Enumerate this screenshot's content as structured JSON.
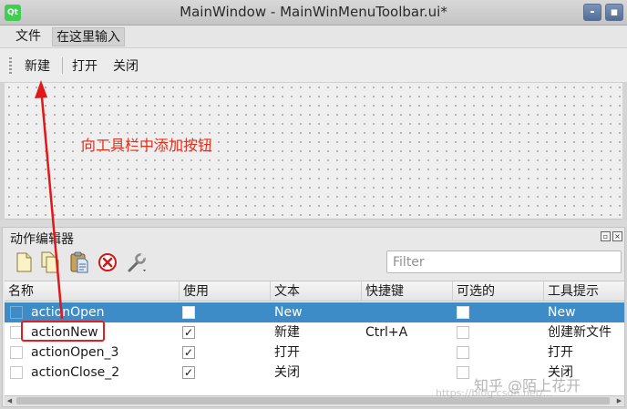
{
  "window": {
    "title": "MainWindow - MainWinMenuToolbar.ui*",
    "app_icon": "Qt",
    "minimize": "-",
    "maximize": "▪"
  },
  "menubar": {
    "file": "文件",
    "type_here": "在这里输入"
  },
  "toolbar": {
    "new": "新建",
    "open": "打开",
    "close": "关闭"
  },
  "annotation": {
    "text": "向工具栏中添加按钮",
    "color": "#e0301e"
  },
  "action_editor": {
    "title": "动作编辑器",
    "tools": [
      "new-action-icon",
      "copy-icon",
      "paste-icon",
      "delete-icon",
      "configure-icon"
    ],
    "filter_placeholder": "Filter",
    "columns": [
      "名称",
      "使用",
      "文本",
      "快捷键",
      "可选的",
      "工具提示"
    ],
    "rows": [
      {
        "name": "actionOpen",
        "used": false,
        "text": "New",
        "shortcut": "",
        "checkable": false,
        "tooltip": "New",
        "selected": true
      },
      {
        "name": "actionNew",
        "used": true,
        "text": "新建",
        "shortcut": "Ctrl+A",
        "checkable": false,
        "tooltip": "创建新文件",
        "selected": false
      },
      {
        "name": "actionOpen_3",
        "used": true,
        "text": "打开",
        "shortcut": "",
        "checkable": false,
        "tooltip": "打开",
        "selected": false
      },
      {
        "name": "actionClose_2",
        "used": true,
        "text": "关闭",
        "shortcut": "",
        "checkable": false,
        "tooltip": "关闭",
        "selected": false
      }
    ],
    "checkmark": "✓",
    "selection_color": "#3d8cc8"
  },
  "watermark": {
    "text": "知乎 @陌上花开",
    "url": "https://blog.csdn.net/..."
  }
}
